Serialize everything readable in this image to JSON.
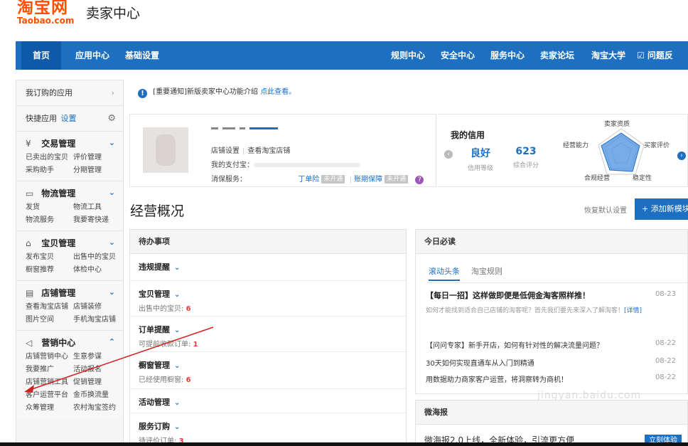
{
  "header": {
    "logo_cn": "淘宝网",
    "logo_en": "Taobao.com",
    "title": "卖家中心"
  },
  "nav": {
    "home": "首页",
    "apps": "应用中心",
    "settings": "基础设置",
    "rules": "规则中心",
    "security": "安全中心",
    "service": "服务中心",
    "forum": "卖家论坛",
    "university": "淘宝大学",
    "feedback": "☑ 问题反馈"
  },
  "sidebar": {
    "subscribed": "我订购的应用",
    "quick": "快捷应用",
    "quick_setting": "设置",
    "groups": [
      {
        "title": "交易管理",
        "icon": "¥",
        "links": [
          "已卖出的宝贝",
          "评价管理",
          "采购助手",
          "分期管理"
        ]
      },
      {
        "title": "物流管理",
        "icon": "▭",
        "links": [
          "发货",
          "物流工具",
          "物流服务",
          "我要寄快递"
        ]
      },
      {
        "title": "宝贝管理",
        "icon": "⌂",
        "links": [
          "发布宝贝",
          "出售中的宝贝",
          "橱窗推荐",
          "体检中心"
        ]
      },
      {
        "title": "店铺管理",
        "icon": "▤",
        "links": [
          "查看淘宝店铺",
          "店铺装修",
          "图片空间",
          "手机淘宝店铺"
        ]
      },
      {
        "title": "营销中心",
        "icon": "◁",
        "links": [
          "店铺营销中心",
          "生意参谋",
          "我要推广",
          "活动报名",
          "店铺营销工具",
          "促销管理",
          "客户运营平台",
          "金币换流量",
          "众筹管理",
          "农村淘宝签约"
        ]
      }
    ]
  },
  "notice": {
    "text": "[重要通知]新版卖家中心功能介绍",
    "link": "点此查看。"
  },
  "shop": {
    "shop_settings": "店铺设置",
    "view_shop": "查看淘宝店铺",
    "account_label": "我的支付宝：",
    "consumer_label": "消保服务：",
    "order_risk": "丁单险",
    "not_open": "未开通",
    "account_protect": "账期保障",
    "help": "?"
  },
  "credit": {
    "title": "我的信用",
    "level_value": "良好",
    "level_label": "信用等级",
    "score_value": "623",
    "score_label": "综合评分",
    "radar_labels": [
      "卖家资质",
      "买家评价",
      "稳定性",
      "合规经营",
      "经营能力"
    ]
  },
  "overview": {
    "title": "经营概况",
    "restore": "恢复默认设置",
    "add_module": "+ 添加新模块"
  },
  "todo": {
    "title": "待办事项",
    "items": [
      {
        "title": "违规提醒",
        "sub_label": "",
        "count": ""
      },
      {
        "title": "宝贝管理",
        "sub_label": "出售中的宝贝:",
        "count": "6"
      },
      {
        "title": "订单提醒",
        "sub_label": "可提前收款订单:",
        "count": "1"
      },
      {
        "title": "橱窗管理",
        "sub_label": "已经使用橱窗:",
        "count": "6"
      },
      {
        "title": "活动管理",
        "sub_label": "",
        "count": ""
      },
      {
        "title": "服务订购",
        "sub_label": "待评价订单:",
        "count": "3"
      }
    ]
  },
  "today": {
    "title": "今日必读",
    "tab_active": "滚动头条",
    "tab_other": "淘宝规则",
    "headline": "【每日一招】这样做即便是低佣金淘客照样推！",
    "headline_date": "08-23",
    "headline_sub": "如何才能找到适合自己店铺的淘客呢？首先我们要先来深入了解淘客！",
    "detail_link": "[详情]",
    "news": [
      {
        "title": "【问问专家】新手开店，如何有针对性的解决流量问题？",
        "date": "08-22"
      },
      {
        "title": "30天如何实现直通车从入门到精通",
        "date": "08-22"
      },
      {
        "title": "用数据助力商家客户运营，将洞察转为商机！",
        "date": "08-22"
      }
    ]
  },
  "micro": {
    "title": "微海报",
    "line": "微海报2.0上线，全新体验，引流更方便",
    "button": "立刻体验"
  },
  "watermark": "jingyan.baidu.com",
  "colors": {
    "brand": "#ff5000",
    "nav": "#1d6fc1",
    "alert": "#e4393c"
  }
}
